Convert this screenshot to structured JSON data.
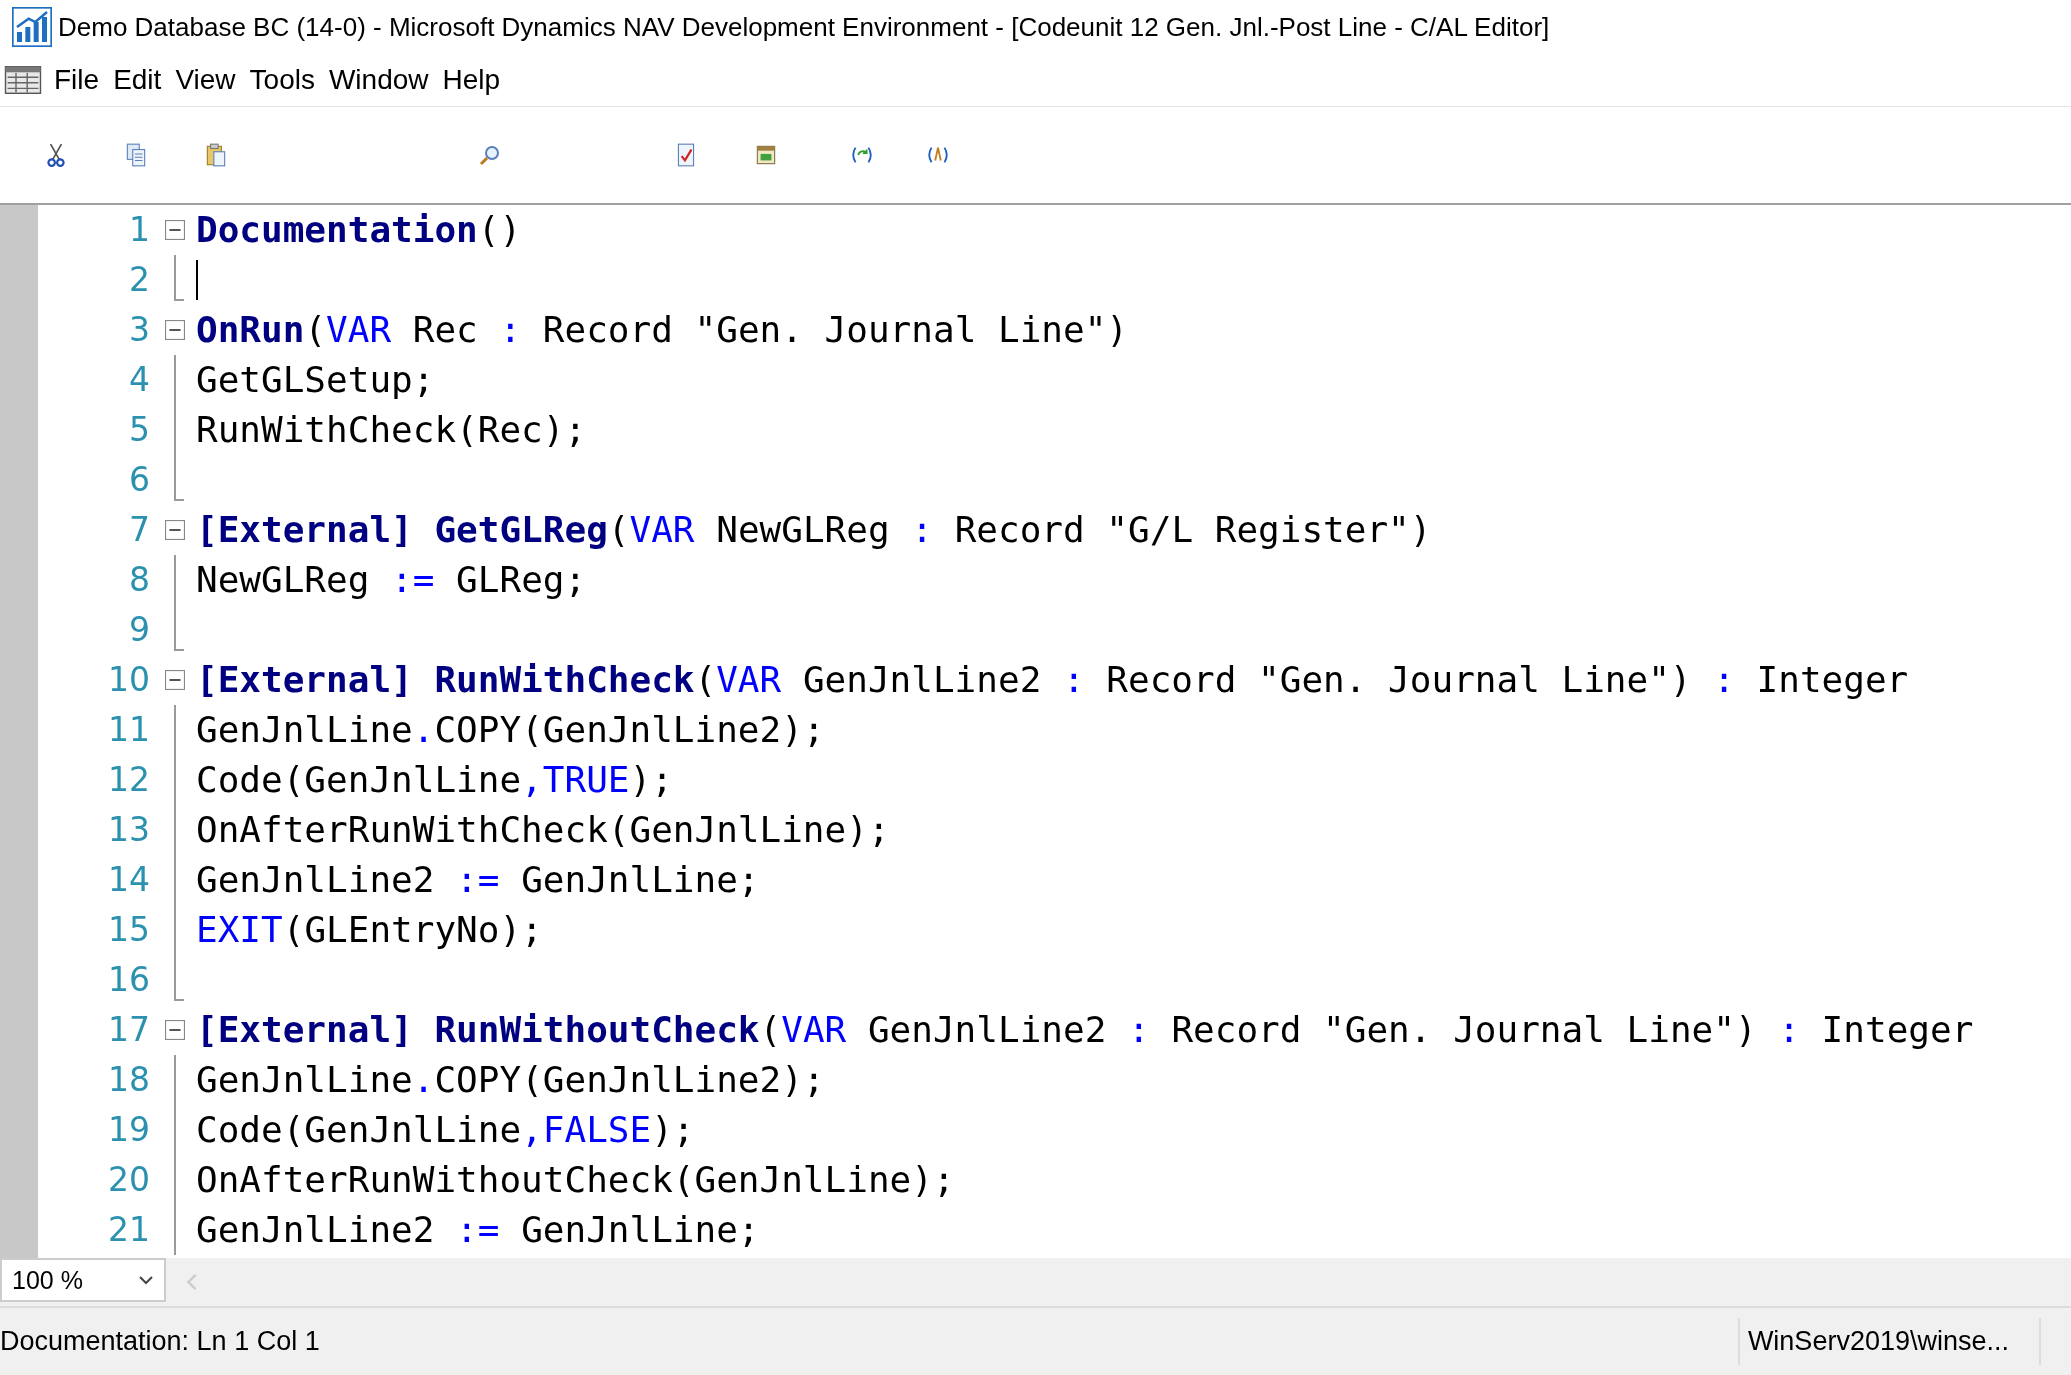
{
  "window": {
    "title": "Demo Database BC (14-0) - Microsoft Dynamics NAV Development Environment - [Codeunit 12 Gen. Jnl.-Post Line - C/AL Editor]"
  },
  "menu": [
    "File",
    "Edit",
    "View",
    "Tools",
    "Window",
    "Help"
  ],
  "editor": {
    "lines": [
      {
        "number": "1",
        "kind": "start",
        "caret": false,
        "tokens": [
          {
            "kind": "fn",
            "text": "Documentation"
          },
          {
            "kind": "text",
            "text": "()"
          }
        ]
      },
      {
        "number": "2",
        "kind": "end",
        "caret": true
      },
      {
        "number": "3",
        "kind": "start",
        "caret": false,
        "tokens": [
          {
            "kind": "fn",
            "text": "OnRun"
          },
          {
            "kind": "text",
            "text": "("
          },
          {
            "kind": "kw",
            "text": "VAR"
          },
          {
            "kind": "text",
            "text": " Rec "
          },
          {
            "kind": "kw",
            "text": ":"
          },
          {
            "kind": "text",
            "text": " Record \"Gen. Journal Line\")"
          }
        ]
      },
      {
        "number": "4",
        "kind": "body",
        "caret": false,
        "tokens": [
          {
            "kind": "text",
            "text": "GetGLSetup;"
          }
        ]
      },
      {
        "number": "5",
        "kind": "body",
        "caret": false,
        "tokens": [
          {
            "kind": "text",
            "text": "RunWithCheck(Rec);"
          }
        ]
      },
      {
        "number": "6",
        "kind": "end",
        "caret": false
      },
      {
        "number": "7",
        "kind": "start",
        "caret": false,
        "tokens": [
          {
            "kind": "fn",
            "text": "[External] GetGLReg"
          },
          {
            "kind": "text",
            "text": "("
          },
          {
            "kind": "kw",
            "text": "VAR"
          },
          {
            "kind": "text",
            "text": " NewGLReg "
          },
          {
            "kind": "kw",
            "text": ":"
          },
          {
            "kind": "text",
            "text": " Record \"G/L Register\")"
          }
        ]
      },
      {
        "number": "8",
        "kind": "body",
        "caret": false,
        "tokens": [
          {
            "kind": "text",
            "text": "NewGLReg "
          },
          {
            "kind": "kw",
            "text": ":="
          },
          {
            "kind": "text",
            "text": " GLReg;"
          }
        ]
      },
      {
        "number": "9",
        "kind": "end",
        "caret": false
      },
      {
        "number": "10",
        "kind": "start",
        "caret": false,
        "tokens": [
          {
            "kind": "fn",
            "text": "[External] RunWithCheck"
          },
          {
            "kind": "text",
            "text": "("
          },
          {
            "kind": "kw",
            "text": "VAR"
          },
          {
            "kind": "text",
            "text": " GenJnlLine2 "
          },
          {
            "kind": "kw",
            "text": ":"
          },
          {
            "kind": "text",
            "text": " Record \"Gen. Journal Line\") "
          },
          {
            "kind": "kw",
            "text": ":"
          },
          {
            "kind": "text",
            "text": " Integer"
          }
        ]
      },
      {
        "number": "11",
        "kind": "body",
        "caret": false,
        "tokens": [
          {
            "kind": "text",
            "text": "GenJnlLine"
          },
          {
            "kind": "kw",
            "text": "."
          },
          {
            "kind": "text",
            "text": "COPY(GenJnlLine2);"
          }
        ]
      },
      {
        "number": "12",
        "kind": "body",
        "caret": false,
        "tokens": [
          {
            "kind": "text",
            "text": "Code(GenJnlLine"
          },
          {
            "kind": "kw",
            "text": ",TRUE"
          },
          {
            "kind": "text",
            "text": ");"
          }
        ]
      },
      {
        "number": "13",
        "kind": "body",
        "caret": false,
        "tokens": [
          {
            "kind": "text",
            "text": "OnAfterRunWithCheck(GenJnlLine);"
          }
        ]
      },
      {
        "number": "14",
        "kind": "body",
        "caret": false,
        "tokens": [
          {
            "kind": "text",
            "text": "GenJnlLine2 "
          },
          {
            "kind": "kw",
            "text": ":="
          },
          {
            "kind": "text",
            "text": " GenJnlLine;"
          }
        ]
      },
      {
        "number": "15",
        "kind": "body",
        "caret": false,
        "tokens": [
          {
            "kind": "kw",
            "text": "EXIT"
          },
          {
            "kind": "text",
            "text": "(GLEntryNo);"
          }
        ]
      },
      {
        "number": "16",
        "kind": "end",
        "caret": false
      },
      {
        "number": "17",
        "kind": "start",
        "caret": false,
        "tokens": [
          {
            "kind": "fn",
            "text": "[External] RunWithoutCheck"
          },
          {
            "kind": "text",
            "text": "("
          },
          {
            "kind": "kw",
            "text": "VAR"
          },
          {
            "kind": "text",
            "text": " GenJnlLine2 "
          },
          {
            "kind": "kw",
            "text": ":"
          },
          {
            "kind": "text",
            "text": " Record \"Gen. Journal Line\") "
          },
          {
            "kind": "kw",
            "text": ":"
          },
          {
            "kind": "text",
            "text": " Integer"
          }
        ]
      },
      {
        "number": "18",
        "kind": "body",
        "caret": false,
        "tokens": [
          {
            "kind": "text",
            "text": "GenJnlLine"
          },
          {
            "kind": "kw",
            "text": "."
          },
          {
            "kind": "text",
            "text": "COPY(GenJnlLine2);"
          }
        ]
      },
      {
        "number": "19",
        "kind": "body",
        "caret": false,
        "tokens": [
          {
            "kind": "text",
            "text": "Code(GenJnlLine"
          },
          {
            "kind": "kw",
            "text": ",FALSE"
          },
          {
            "kind": "text",
            "text": ");"
          }
        ]
      },
      {
        "number": "20",
        "kind": "body",
        "caret": false,
        "tokens": [
          {
            "kind": "text",
            "text": "OnAfterRunWithoutCheck(GenJnlLine);"
          }
        ]
      },
      {
        "number": "21",
        "kind": "body",
        "caret": false,
        "tokens": [
          {
            "kind": "text",
            "text": "GenJnlLine2 "
          },
          {
            "kind": "kw",
            "text": ":="
          },
          {
            "kind": "text",
            "text": " GenJnlLine;"
          }
        ]
      }
    ]
  },
  "zoom": {
    "value": "100 %"
  },
  "status_bar": {
    "left": "Documentation: Ln 1 Col 1",
    "right": "WinServ2019\\winse..."
  }
}
